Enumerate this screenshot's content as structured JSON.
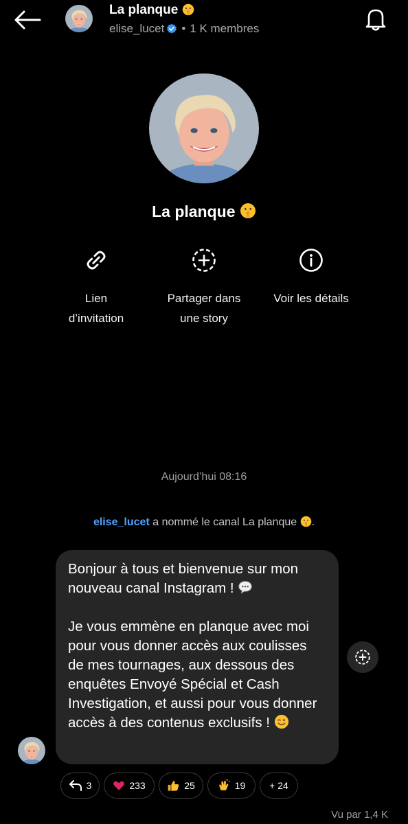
{
  "header": {
    "title": "La planque",
    "username": "elise_lucet",
    "separator": "•",
    "members": "1 K membres"
  },
  "profile": {
    "name": "La planque"
  },
  "actions": [
    {
      "label_line1": "Lien",
      "label_line2": "d’invitation"
    },
    {
      "label_line1": "Partager dans",
      "label_line2": "une story"
    },
    {
      "label_line1": "Voir les détails",
      "label_line2": ""
    }
  ],
  "timestamp": "Aujourd’hui 08:16",
  "system_message": {
    "user": "elise_lucet",
    "text": "a nommé le canal La planque",
    "end": "."
  },
  "message": {
    "line1": "Bonjour à tous et bienvenue sur mon nouveau canal Instagram !",
    "line2": "Je vous emmène en planque avec moi pour vous donner accès aux coulisses de mes tournages, aux dessous des enquêtes Envoyé Spécial et Cash Investigation, et aussi pour vous donner accès à des contenus exclusifs !"
  },
  "reactions": [
    {
      "icon": "reply-icon",
      "count": "3"
    },
    {
      "icon": "red-heart-emoji",
      "count": "233"
    },
    {
      "icon": "thumbs-up-emoji",
      "count": "25"
    },
    {
      "icon": "clapping-hands-emoji",
      "count": "19"
    },
    {
      "icon": "",
      "count": "+ 24"
    }
  ],
  "seen_by": "Vu par 1,4 K",
  "colors": {
    "background": "#000000",
    "bubble": "#262626",
    "link_blue": "#4da3ff",
    "verified_blue": "#3897f0",
    "muted": "#a8a8a8"
  }
}
